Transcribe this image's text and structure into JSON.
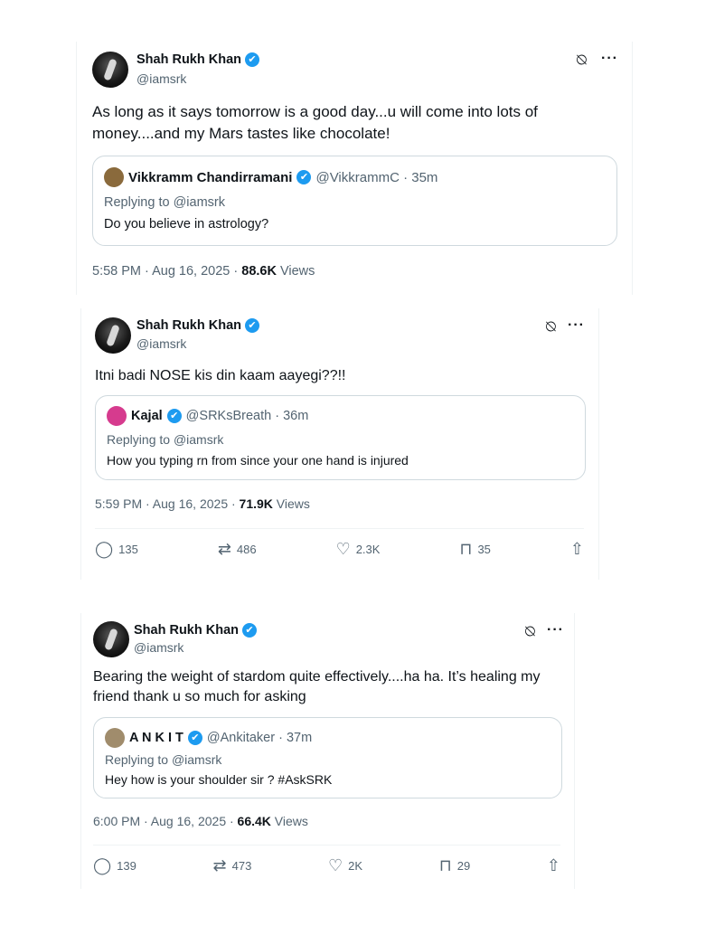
{
  "tweets": [
    {
      "author": {
        "name": "Shah Rukh Khan",
        "handle": "@iamsrk"
      },
      "text": "As long as it says tomorrow is a good day...u will come into lots of money....and my Mars tastes like chocolate!",
      "quote": {
        "name": "Vikkramm Chandirramani",
        "meta": "@VikkrammC · 35m",
        "reply_prefix": "Replying to",
        "reply_to": "@iamsrk",
        "text": "Do you believe in astrology?",
        "avatar_color": "#8a6a3c"
      },
      "time": "5:58 PM · Aug 16, 2025 ·",
      "views_count": "88.6K",
      "views_label": "Views"
    },
    {
      "author": {
        "name": "Shah Rukh Khan",
        "handle": "@iamsrk"
      },
      "text": "Itni badi NOSE kis din kaam aayegi??!!",
      "quote": {
        "name": "Kajal",
        "meta": "@SRKsBreath · 36m",
        "reply_prefix": "Replying to",
        "reply_to": "@iamsrk",
        "text": "How you typing rn from since your one hand is injured",
        "avatar_color": "#d63b8e"
      },
      "time": "5:59 PM · Aug 16, 2025 ·",
      "views_count": "71.9K",
      "views_label": "Views",
      "actions": {
        "replies": "135",
        "reposts": "486",
        "likes": "2.3K",
        "bookmarks": "35"
      }
    },
    {
      "author": {
        "name": "Shah Rukh Khan",
        "handle": "@iamsrk"
      },
      "text": "Bearing the weight of stardom quite effectively....ha ha. It’s healing my friend thank u so much for asking",
      "quote": {
        "name": "A N K I T",
        "meta": "@Ankitaker · 37m",
        "reply_prefix": "Replying to",
        "reply_to": "@iamsrk",
        "text": "Hey how is your shoulder sir ? #AskSRK",
        "avatar_color": "#a08c6c"
      },
      "time": "6:00 PM · Aug 16, 2025 ·",
      "views_count": "66.4K",
      "views_label": "Views",
      "actions": {
        "replies": "139",
        "reposts": "473",
        "likes": "2K",
        "bookmarks": "29"
      }
    }
  ],
  "icons": {
    "verified": "✔",
    "grok": "⍉",
    "more": "···",
    "reply": "◯",
    "repost": "⇄",
    "like": "♡",
    "bookmark": "⊓",
    "share": "⇧"
  },
  "colors": {
    "accent": "#1d9bf0",
    "muted": "#536471",
    "text": "#0f1419",
    "border": "#cfd9de"
  }
}
